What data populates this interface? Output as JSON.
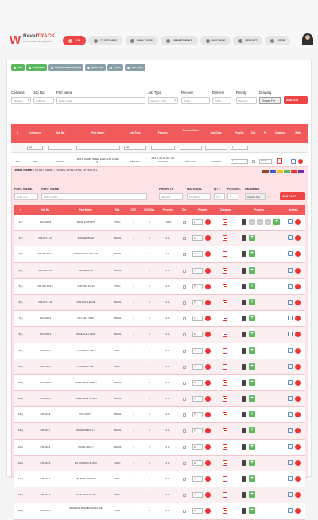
{
  "brand": {
    "name_part1": "Revel",
    "name_part2": "TRACK",
    "tagline": "work process tracking system"
  },
  "nav": {
    "items": [
      {
        "label": "JOB",
        "active": true
      },
      {
        "label": "CUSTOMER",
        "active": false
      },
      {
        "label": "EMPLOYEE",
        "active": false
      },
      {
        "label": "DEPARTMENT",
        "active": false
      },
      {
        "label": "MACHINE",
        "active": false
      },
      {
        "label": "REPORT",
        "active": false
      },
      {
        "label": "USER",
        "active": false
      }
    ]
  },
  "toolbar_pills": [
    "JOB",
    "DELIVERY",
    "DEPARTMENT STATUS",
    "PROCESS",
    "LEVEL",
    "JOB TYPE"
  ],
  "filters": {
    "customer_label": "Customer",
    "customer_value": "SELECT",
    "jobno_label": "Job No.",
    "jobno_placeholder": "JOB NO.",
    "partname_label": "Part Name",
    "partname_placeholder": "PART NAME",
    "jobtype_label": "Job Type",
    "jobtype_value": "SELECT TYPE",
    "receive_label": "Receive",
    "receive_placeholder": "DATE",
    "delivery_label": "Delivery",
    "delivery_placeholder": "DATE",
    "priority_label": "Priority",
    "priority_value": "SELECT",
    "drawing_label": "Drawing",
    "choose_file": "Choose File",
    "add_job": "ADD JOB"
  },
  "job_table": {
    "headers": [
      "#",
      "Customer.",
      "Job No.",
      "Part Name.",
      "Job Type.",
      "Percent.",
      "Receive Date.",
      "Due Date.",
      "Priority.",
      "Del.",
      "Pr.",
      "Drawing.",
      "Edit."
    ],
    "filter_customer": "ALL",
    "filter_jobtype": "ALL",
    "filter_priority": "1",
    "row": {
      "index": "1[+]",
      "customer": "GRD",
      "job_no": "500-063",
      "part_name": "MOLD NAME : REBEL EHW-CHW LEVER # 1",
      "job_type": "DESIGNT",
      "percent": "2.22 % (30-30-OH / 50-100-33%)",
      "receive_date": "05/07/2017",
      "due_date": "10/07/2017",
      "priority": "1",
      "send_label": "Send"
    }
  },
  "parts_section": {
    "jobs_name_label": "JOBS NAME :",
    "jobs_name_value": "MOLD NAME : REBEL EHW-CHW LEVER # 1",
    "legend_colors": [
      "#8a4a2a",
      "#3a5fcd",
      "#f0c020",
      "#5cb85c",
      "#e33",
      "#7a2aa0"
    ],
    "part_no_label": "PART NAME.",
    "part_no_placeholder": "PART NO.",
    "part_name_label": "PART NAME",
    "part_name_placeholder": "PART NAME",
    "priority_label": "PRIORITY",
    "priority_value": "SELECT",
    "material_label": "MATERIAL",
    "material_placeholder": "MATERIAL",
    "qty_label": "QTY.",
    "qty_placeholder": "QTY.",
    "pcs_label": "PCS/SET.",
    "pcs_value": "1",
    "drawing_label": "DRAWING",
    "choose_file": "Choose File",
    "file_status": "N",
    "add_part": "ADD PART",
    "headers": [
      "#",
      "Job No.",
      "Part Name.",
      "Mat.",
      "QTY.",
      "PSC/Set.",
      "Percent.",
      "Del.",
      "Priority.",
      "Drawing.",
      "Process.",
      "Deleted."
    ],
    "rows": [
      {
        "idx": "1[+]",
        "job": "005-042-18",
        "name": "MOVE SUPPORT",
        "mat": "S50C",
        "qty": "1",
        "pcs": "1",
        "pct": "2.22 %",
        "pri": "1"
      },
      {
        "idx": "2[+]",
        "job": "005-042-1-17",
        "name": "PUNGER BUSH",
        "mat": "SKD61",
        "qty": "1",
        "pcs": "1",
        "pct": "0 %",
        "pri": "2"
      },
      {
        "idx": "3[+]",
        "job": "005-042-1-16-1",
        "name": "SPRUE BUSH COLLAR",
        "mat": "SKD61",
        "qty": "1",
        "pcs": "1",
        "pct": "0 %",
        "pri": "3"
      },
      {
        "idx": "4[+]",
        "job": "005-042-1-16",
        "name": "SPRUE BUSH",
        "mat": "SKD61",
        "qty": "1",
        "pcs": "1",
        "pct": "0 %",
        "pri": "4"
      },
      {
        "idx": "5[+]",
        "job": "005-042-1-15-1",
        "name": "COOLING PLUG",
        "mat": "S50C",
        "qty": "1",
        "pcs": "1",
        "pct": "0 %",
        "pri": "5"
      },
      {
        "idx": "6[+]",
        "job": "005-042-1-15",
        "name": "CENTER SLEEVE",
        "mat": "SKD61",
        "qty": "1",
        "pcs": "1",
        "pct": "0 %",
        "pri": "6"
      },
      {
        "idx": "7[+]",
        "job": "005-042-14",
        "name": "FIX CHILL VENT",
        "mat": "SKD61",
        "qty": "1",
        "pcs": "1",
        "pct": "0 %",
        "pri": "7"
      },
      {
        "idx": "8[+]",
        "job": "005-042-13",
        "name": "MOVE CHILL VENT",
        "mat": "SKD61",
        "qty": "1",
        "pcs": "1",
        "pct": "0 %",
        "pri": "8"
      },
      {
        "idx": "9[+]",
        "job": "005-042-12",
        "name": "EJECTOR PLATE B",
        "mat": "S50C",
        "qty": "1",
        "pcs": "1",
        "pct": "0 %",
        "pri": "9"
      },
      {
        "idx": "10[+]",
        "job": "005-042-11",
        "name": "EJECTOR PLATE A",
        "mat": "S50C",
        "qty": "1",
        "pcs": "1",
        "pct": "0 %",
        "pri": "10"
      },
      {
        "idx": "11[+]",
        "job": "005-042-10",
        "name": "SLIDE CORE INSERT",
        "mat": "SKD61",
        "qty": "1",
        "pcs": "1",
        "pct": "0 %",
        "pri": "11"
      },
      {
        "idx": "12[+]",
        "job": "005-042-9",
        "name": "SLIDE CORE S1,S2,3",
        "mat": "SKD61",
        "qty": "1",
        "pcs": "1",
        "pct": "0 %",
        "pri": "12"
      },
      {
        "idx": "13[+]",
        "job": "005-042-8",
        "name": "FIX CAVITY",
        "mat": "SKD61",
        "qty": "1",
        "pcs": "1",
        "pct": "0 %",
        "pri": "13"
      },
      {
        "idx": "14[+]",
        "job": "005-042-7",
        "name": "MOVE INSERT 1,2",
        "mat": "SKD61",
        "qty": "1",
        "pcs": "1",
        "pct": "0 %",
        "pri": "14"
      },
      {
        "idx": "15[+]",
        "job": "005-042-6",
        "name": "MOVE CAVITY",
        "mat": "SKD61",
        "qty": "1",
        "pcs": "1",
        "pct": "0 %",
        "pri": "15"
      },
      {
        "idx": "16[+]",
        "job": "005-042-5",
        "name": "FIX HOLDING BLOCK",
        "mat": "S50C",
        "qty": "1",
        "pcs": "1",
        "pct": "0 %",
        "pri": "16"
      },
      {
        "idx": "17[+]",
        "job": "005-042-4",
        "name": "DIE BASE SPACER",
        "mat": "S50C",
        "qty": "1",
        "pcs": "1",
        "pct": "0 %",
        "pri": "17"
      },
      {
        "idx": "18[+]",
        "job": "005-042-3",
        "name": "MOVE BASE PLATE",
        "mat": "S50C",
        "qty": "1",
        "pcs": "1",
        "pct": "0 %",
        "pri": "18"
      },
      {
        "idx": "19[+]",
        "job": "005-042-2",
        "name": "MOVE HOLDING BLOCK PLATE",
        "mat": "S50C",
        "qty": "1",
        "pcs": "1",
        "pct": "0 %",
        "pri": "19"
      }
    ]
  }
}
